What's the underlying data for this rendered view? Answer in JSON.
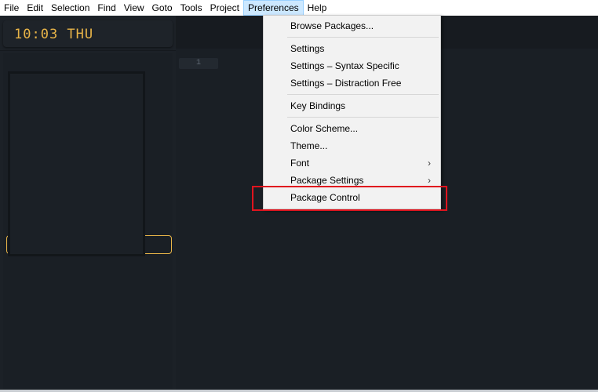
{
  "menubar": {
    "items": [
      "File",
      "Edit",
      "Selection",
      "Find",
      "View",
      "Goto",
      "Tools",
      "Project",
      "Preferences",
      "Help"
    ],
    "active": "Preferences"
  },
  "sidebar": {
    "clock": "10:03 THU"
  },
  "editor": {
    "line_number": "1"
  },
  "preferences_menu": {
    "items": [
      {
        "label": "Browse Packages...",
        "submenu": false
      },
      {
        "label": "Settings",
        "submenu": false
      },
      {
        "label": "Settings – Syntax Specific",
        "submenu": false
      },
      {
        "label": "Settings – Distraction Free",
        "submenu": false
      },
      {
        "label": "Key Bindings",
        "submenu": false
      },
      {
        "label": "Color Scheme...",
        "submenu": false
      },
      {
        "label": "Theme...",
        "submenu": false
      },
      {
        "label": "Font",
        "submenu": true
      },
      {
        "label": "Package Settings",
        "submenu": true
      },
      {
        "label": "Package Control",
        "submenu": false
      }
    ],
    "highlighted": "Package Control"
  },
  "colors": {
    "accent_gold": "#e8b448",
    "highlight_red": "#e0141e",
    "editor_bg": "#1a1f25",
    "menu_bg": "#f2f2f2"
  }
}
